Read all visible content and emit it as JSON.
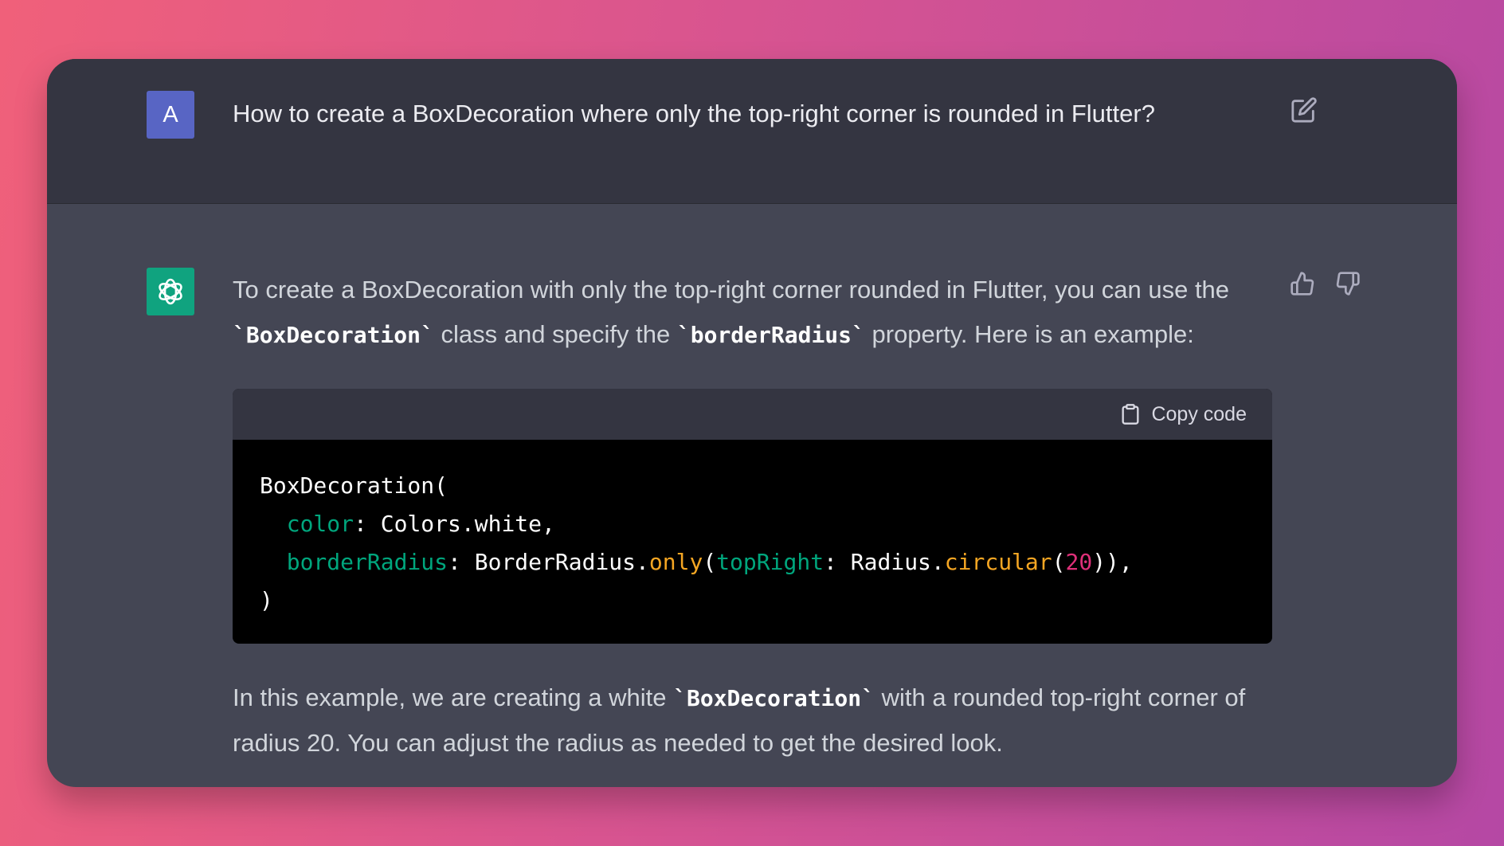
{
  "user": {
    "avatar_letter": "A",
    "message": "How to create a BoxDecoration where only the top-right corner is rounded in Flutter?"
  },
  "assistant": {
    "intro_part1": "To create a BoxDecoration with only the top-right corner rounded in Flutter, you can use the ",
    "code1": "`BoxDecoration`",
    "intro_part2": " class and specify the ",
    "code2": "`borderRadius`",
    "intro_part3": " property. Here is an example:",
    "copy_label": "Copy code",
    "code_lines": {
      "l1": "BoxDecoration(",
      "l2_indent": "  ",
      "l2_prop": "color",
      "l2_rest": ": Colors.white,",
      "l3_indent": "  ",
      "l3_prop": "borderRadius",
      "l3_a": ": BorderRadius.",
      "l3_fn1": "only",
      "l3_b": "(",
      "l3_prop2": "topRight",
      "l3_c": ": Radius.",
      "l3_fn2": "circular",
      "l3_d": "(",
      "l3_num": "20",
      "l3_e": ")),",
      "l4": ")"
    },
    "outro_part1": "In this example, we are creating a white ",
    "code3": "`BoxDecoration`",
    "outro_part2": " with a rounded top-right corner of radius 20. You can adjust the radius as needed to get the desired look."
  },
  "colors": {
    "accent_green": "#10a37f",
    "user_avatar": "#5865c4",
    "keyword_green": "#00a67d",
    "function_orange": "#f5a623",
    "number_pink": "#df3079"
  },
  "icons": [
    "edit-icon",
    "openai-logo-icon",
    "thumbs-up-icon",
    "thumbs-down-icon",
    "clipboard-icon"
  ]
}
